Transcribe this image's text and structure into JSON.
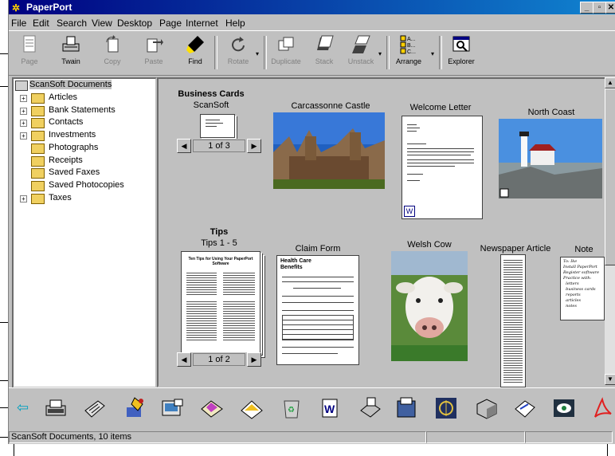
{
  "title": "PaperPort",
  "menu": [
    "File",
    "Edit",
    "Search",
    "View",
    "Desktop",
    "Page",
    "Internet",
    "Help"
  ],
  "toolbar": [
    {
      "label": "Page",
      "disabled": true,
      "icon": "page-icon"
    },
    {
      "label": "Twain",
      "disabled": false,
      "icon": "scanner-icon"
    },
    {
      "label": "Copy",
      "disabled": true,
      "icon": "copy-icon"
    },
    {
      "label": "Paste",
      "disabled": true,
      "icon": "paste-icon"
    },
    {
      "label": "Find",
      "disabled": false,
      "icon": "flashlight-icon"
    },
    {
      "label": "Rotate",
      "disabled": true,
      "icon": "rotate-icon"
    },
    {
      "label": "Duplicate",
      "disabled": true,
      "icon": "duplicate-icon"
    },
    {
      "label": "Stack",
      "disabled": true,
      "icon": "stack-icon"
    },
    {
      "label": "Unstack",
      "disabled": true,
      "icon": "unstack-icon"
    },
    {
      "label": "Arrange",
      "disabled": false,
      "icon": "arrange-icon"
    },
    {
      "label": "Explorer",
      "disabled": false,
      "icon": "explorer-icon"
    }
  ],
  "tree": {
    "root": "ScanSoft Documents",
    "items": [
      {
        "label": "Articles",
        "expandable": true
      },
      {
        "label": "Bank Statements",
        "expandable": true
      },
      {
        "label": "Contacts",
        "expandable": true
      },
      {
        "label": "Investments",
        "expandable": true
      },
      {
        "label": "Photographs",
        "expandable": false
      },
      {
        "label": "Receipts",
        "expandable": false
      },
      {
        "label": "Saved Faxes",
        "expandable": false
      },
      {
        "label": "Saved Photocopies",
        "expandable": false
      },
      {
        "label": "Taxes",
        "expandable": true
      }
    ]
  },
  "desktop": {
    "business_cards": {
      "heading": "Business Cards",
      "sub": "ScanSoft",
      "counter": "1 of 3"
    },
    "tips": {
      "heading": "Tips",
      "sub": "Tips 1 - 5",
      "counter": "1 of 2",
      "doc_title": "Ten Tips for Using Your PaperPort Software"
    },
    "items": [
      {
        "label": "Carcassonne Castle"
      },
      {
        "label": "Welcome Letter"
      },
      {
        "label": "North Coast"
      },
      {
        "label": "Claim Form",
        "doc_title": "Health Care Benefits"
      },
      {
        "label": "Welsh Cow"
      },
      {
        "label": "Newspaper Article"
      },
      {
        "label": "Note",
        "note_text": "To: Ike\nInstall PaperPort\nRegister software\nPractice with:\n  letters\n  business cards\n  reports\n  articles\n  notes"
      }
    ]
  },
  "sendto": [
    "Left scroll",
    "Typewriter",
    "Fax",
    "Ink",
    "Scanner",
    "Envelope",
    "Mail",
    "Recycle",
    "Word",
    "Printer",
    "Mail server",
    "Bridge",
    "Cube",
    "Send",
    "Eye",
    "Acrobat",
    "Paint",
    "Right scroll"
  ],
  "status": {
    "text": "ScanSoft Documents, 10 items"
  },
  "colors": {
    "titlebar": "#000080",
    "face": "#c0c0c0",
    "folder": "#f0d060"
  }
}
